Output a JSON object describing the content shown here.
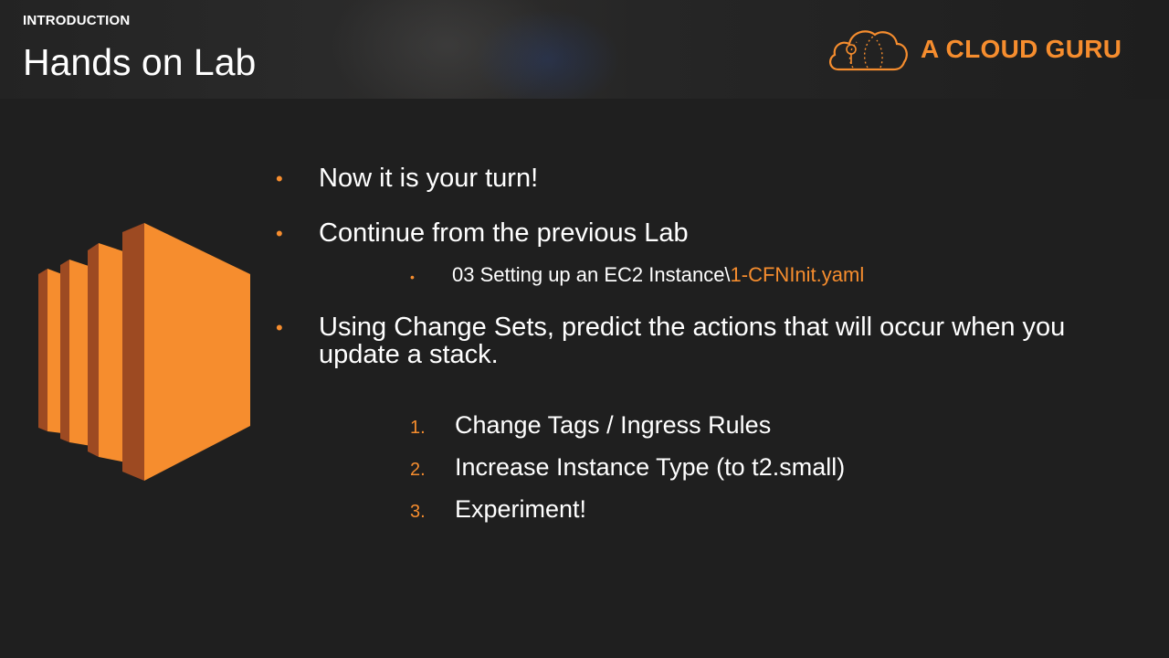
{
  "header": {
    "section_label": "INTRODUCTION",
    "title": "Hands on Lab"
  },
  "logo": {
    "text": "A CLOUD GURU",
    "icon": "cloud-logo-icon",
    "color": "#f68d2e"
  },
  "illustration": {
    "icon": "ec2-instance-icon",
    "colors": {
      "front": "#f68d2e",
      "side": "#9d4a22"
    }
  },
  "bullets": [
    {
      "text": "Now it is your turn!"
    },
    {
      "text": "Continue from the previous Lab",
      "sub": {
        "prefix": "03 Setting up an EC2 Instance\\",
        "highlight": "1-CFNInit.yaml"
      }
    },
    {
      "line1": "Using Change Sets, predict the actions that will occur when you",
      "line2": "update a stack."
    }
  ],
  "steps": [
    {
      "number": "1.",
      "text": "Change Tags / Ingress Rules"
    },
    {
      "number": "2.",
      "text": "Increase Instance Type (to t2.small)"
    },
    {
      "number": "3.",
      "text": "Experiment!"
    }
  ],
  "bullet_symbol": "•",
  "accent_color": "#f68d2e"
}
